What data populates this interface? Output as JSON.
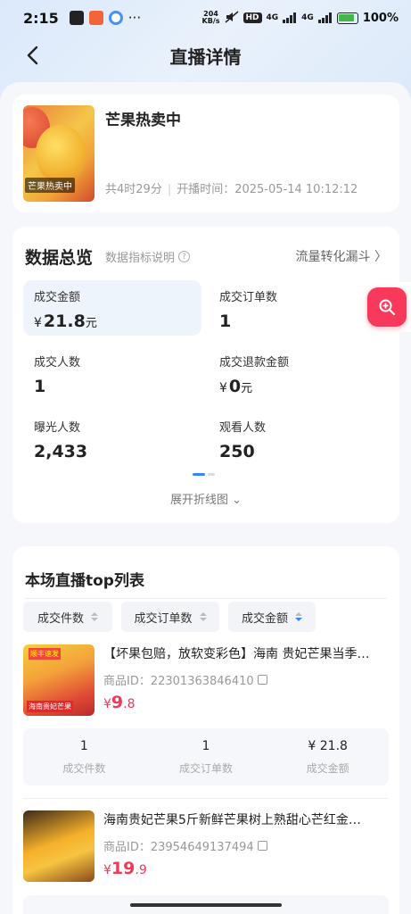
{
  "status_bar": {
    "time": "2:15",
    "net_speed": "204\nKB/s",
    "hd": "HD",
    "signal1": "4G",
    "signal2": "4G",
    "battery": "100%"
  },
  "header": {
    "title": "直播详情"
  },
  "live": {
    "title": "芒果热卖中",
    "thumb_tag": "芒果热卖中",
    "duration": "共4时29分",
    "start_label": "开播时间：2025-05-14 10:12:12"
  },
  "overview": {
    "title": "数据总览",
    "explain": "数据指标说明",
    "funnel": "流量转化漏斗 〉",
    "metrics": [
      {
        "label": "成交金额",
        "currency": "¥",
        "value": "21.8",
        "unit": "元"
      },
      {
        "label": "成交订单数",
        "currency": "",
        "value": "1",
        "unit": ""
      },
      {
        "label": "成交人数",
        "currency": "",
        "value": "1",
        "unit": ""
      },
      {
        "label": "成交退款金额",
        "currency": "¥",
        "value": "0",
        "unit": "元"
      },
      {
        "label": "曝光人数",
        "currency": "",
        "value": "2,433",
        "unit": ""
      },
      {
        "label": "观看人数",
        "currency": "",
        "value": "250",
        "unit": ""
      }
    ],
    "expand": "展开折线图 ⌄"
  },
  "top_list": {
    "title": "本场直播top列表",
    "sort_buttons": [
      "成交件数",
      "成交订单数",
      "成交金额"
    ],
    "products": [
      {
        "title": "【坏果包赔，放软变彩色】海南 贵妃芒果当季…",
        "id": "商品ID：22301363846410",
        "currency": "¥",
        "price_int": "9",
        "price_dec": ".8",
        "img_badge": "顺丰速发",
        "img_banner": "海南贵妃芒果",
        "stats": [
          {
            "value": "1",
            "label": "成交件数"
          },
          {
            "value": "1",
            "label": "成交订单数"
          },
          {
            "value": "¥ 21.8",
            "label": "成交金额"
          }
        ]
      },
      {
        "title": "海南贵妃芒果5斤新鲜芒果树上熟甜心芒红金…",
        "id": "商品ID：23954649137494",
        "currency": "¥",
        "price_int": "19",
        "price_dec": ".9"
      }
    ]
  },
  "colors": {
    "accent": "#3a86f7",
    "price": "#f03a5a",
    "fab": "#f8395c"
  }
}
